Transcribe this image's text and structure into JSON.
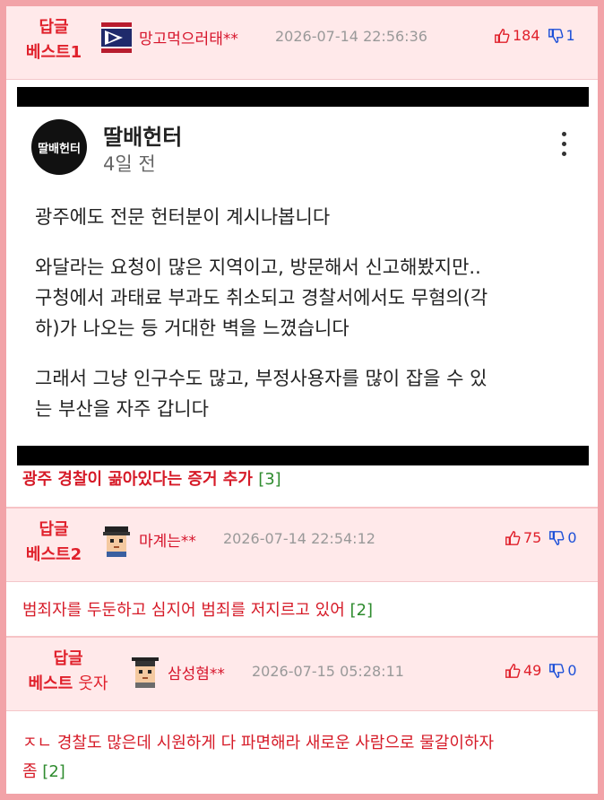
{
  "replies": [
    {
      "badge_top": "답글",
      "badge_bottom": "베스트1",
      "badge_suffix": "",
      "nickname": "망고먹으러태**",
      "datetime": "2026-07-14 22:56:36",
      "upvotes": "184",
      "downvotes": "1",
      "embed": {
        "username": "딸배헌터",
        "avatar_text": "딸배헌터",
        "time_ago": "4일 전",
        "paragraphs": [
          "광주에도 전문 헌터분이 계시나봅니다",
          "와달라는 요청이 많은 지역이고, 방문해서 신고해봤지만..\n구청에서 과태료 부과도 취소되고 경찰서에서도 무혐의(각\n하)가 나오는 등 거대한 벽을 느꼈습니다",
          "그래서 그냥 인구수도 많고, 부정사용자를 많이 잡을 수 있\n는 부산을 자주 갑니다"
        ]
      },
      "text": "광주 경찰이 곪아있다는 증거 추가",
      "comment_count": "[3]"
    },
    {
      "badge_top": "답글",
      "badge_bottom": "베스트2",
      "badge_suffix": "",
      "nickname": "마계는**",
      "datetime": "2026-07-14 22:54:12",
      "upvotes": "75",
      "downvotes": "0",
      "text": "범죄자를 두둔하고 심지어 범죄를 저지르고 있어",
      "comment_count": "[2]"
    },
    {
      "badge_top": "답글",
      "badge_bottom": "베스트",
      "badge_suffix": "웃자",
      "nickname": "삼성혐**",
      "datetime": "2026-07-15 05:28:11",
      "upvotes": "49",
      "downvotes": "0",
      "text_line1": "ㅈㄴ 경찰도 많은데 시원하게 다 파면해라 새로운 사람으로 물갈이하자",
      "text_line2": "좀",
      "comment_count": "[2]"
    }
  ],
  "colors": {
    "accent_red": "#e0202b",
    "header_bg": "#ffe9ea",
    "frame_border": "#f2a3a8",
    "downvote_blue": "#1c4fd8",
    "count_green": "#2e8b2e"
  },
  "icons": [
    "thumbs-up-icon",
    "thumbs-down-icon",
    "kebab-menu-icon"
  ]
}
